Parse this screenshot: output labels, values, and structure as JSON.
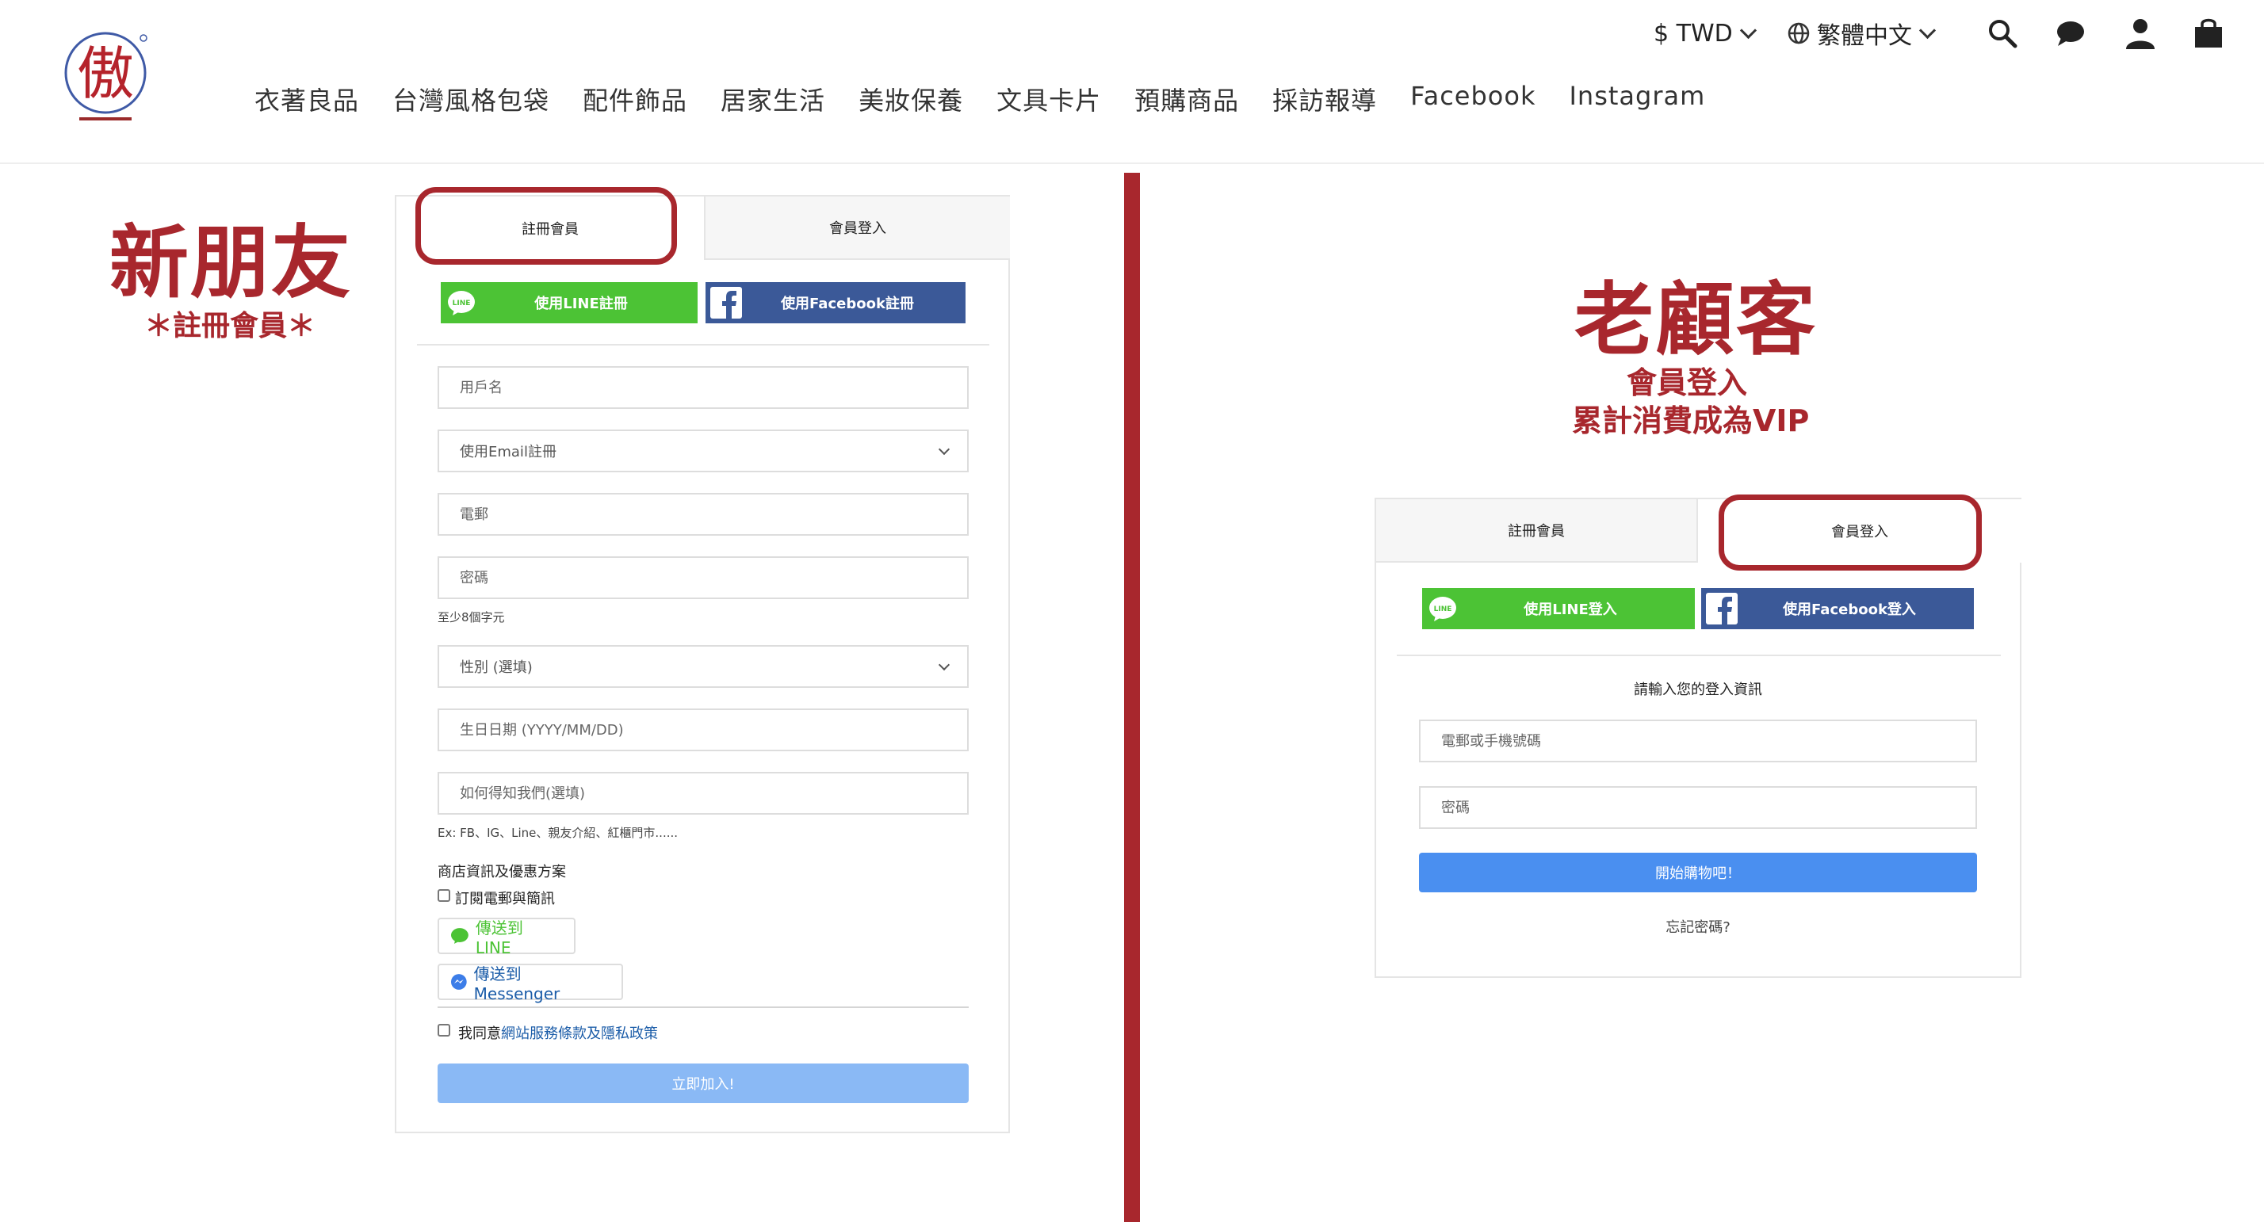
{
  "header": {
    "logo_alt": "傲",
    "nav": [
      "衣著良品",
      "台灣風格包袋",
      "配件飾品",
      "居家生活",
      "美妝保養",
      "文具卡片",
      "預購商品",
      "採訪報導",
      "Facebook",
      "Instagram"
    ],
    "currency": "$ TWD",
    "language": "繁體中文"
  },
  "annotations": {
    "left_title": "新朋友",
    "left_subtitle": "＊註冊會員＊",
    "right_title": "老顧客",
    "right_subtitle_1": "會員登入",
    "right_subtitle_2": "累計消費成為VIP"
  },
  "register_card": {
    "tabs": {
      "register": "註冊會員",
      "login": "會員登入"
    },
    "line_button": "使用LINE註冊",
    "fb_button": "使用Facebook註冊",
    "fields": {
      "username": "用戶名",
      "register_method": "使用Email註冊",
      "email": "電郵",
      "password": "密碼",
      "password_hint": "至少8個字元",
      "gender": "性別 (選填)",
      "birthday": "生日日期 (YYYY/MM/DD)",
      "referral": "如何得知我們(選填)",
      "referral_hint": "Ex: FB、IG、Line、親友介紹、紅櫃門市......"
    },
    "newsletter_title": "商店資訊及優惠方案",
    "newsletter_checkbox": "訂閱電郵與簡訊",
    "send_line": "傳送到 LINE",
    "send_messenger": "傳送到 Messenger",
    "agree_prefix": "我同意",
    "agree_link": "網站服務條款及隱私政策",
    "submit": "立即加入!"
  },
  "login_card": {
    "tabs": {
      "register": "註冊會員",
      "login": "會員登入"
    },
    "line_button": "使用LINE登入",
    "fb_button": "使用Facebook登入",
    "prompt": "請輸入您的登入資訊",
    "fields": {
      "account": "電郵或手機號碼",
      "password": "密碼"
    },
    "submit": "開始購物吧！",
    "forgot": "忘記密碼?"
  },
  "colors": {
    "accent_red": "#a8272d",
    "line_green": "#4cc335",
    "facebook_blue": "#3b5998",
    "submit_disabled": "#8ab9f5",
    "submit_active": "#4a8ff0"
  },
  "icons": {
    "search": "search-icon",
    "chat": "chat-icon",
    "user": "user-icon",
    "cart": "shopping-bag-icon",
    "globe": "globe-icon"
  }
}
